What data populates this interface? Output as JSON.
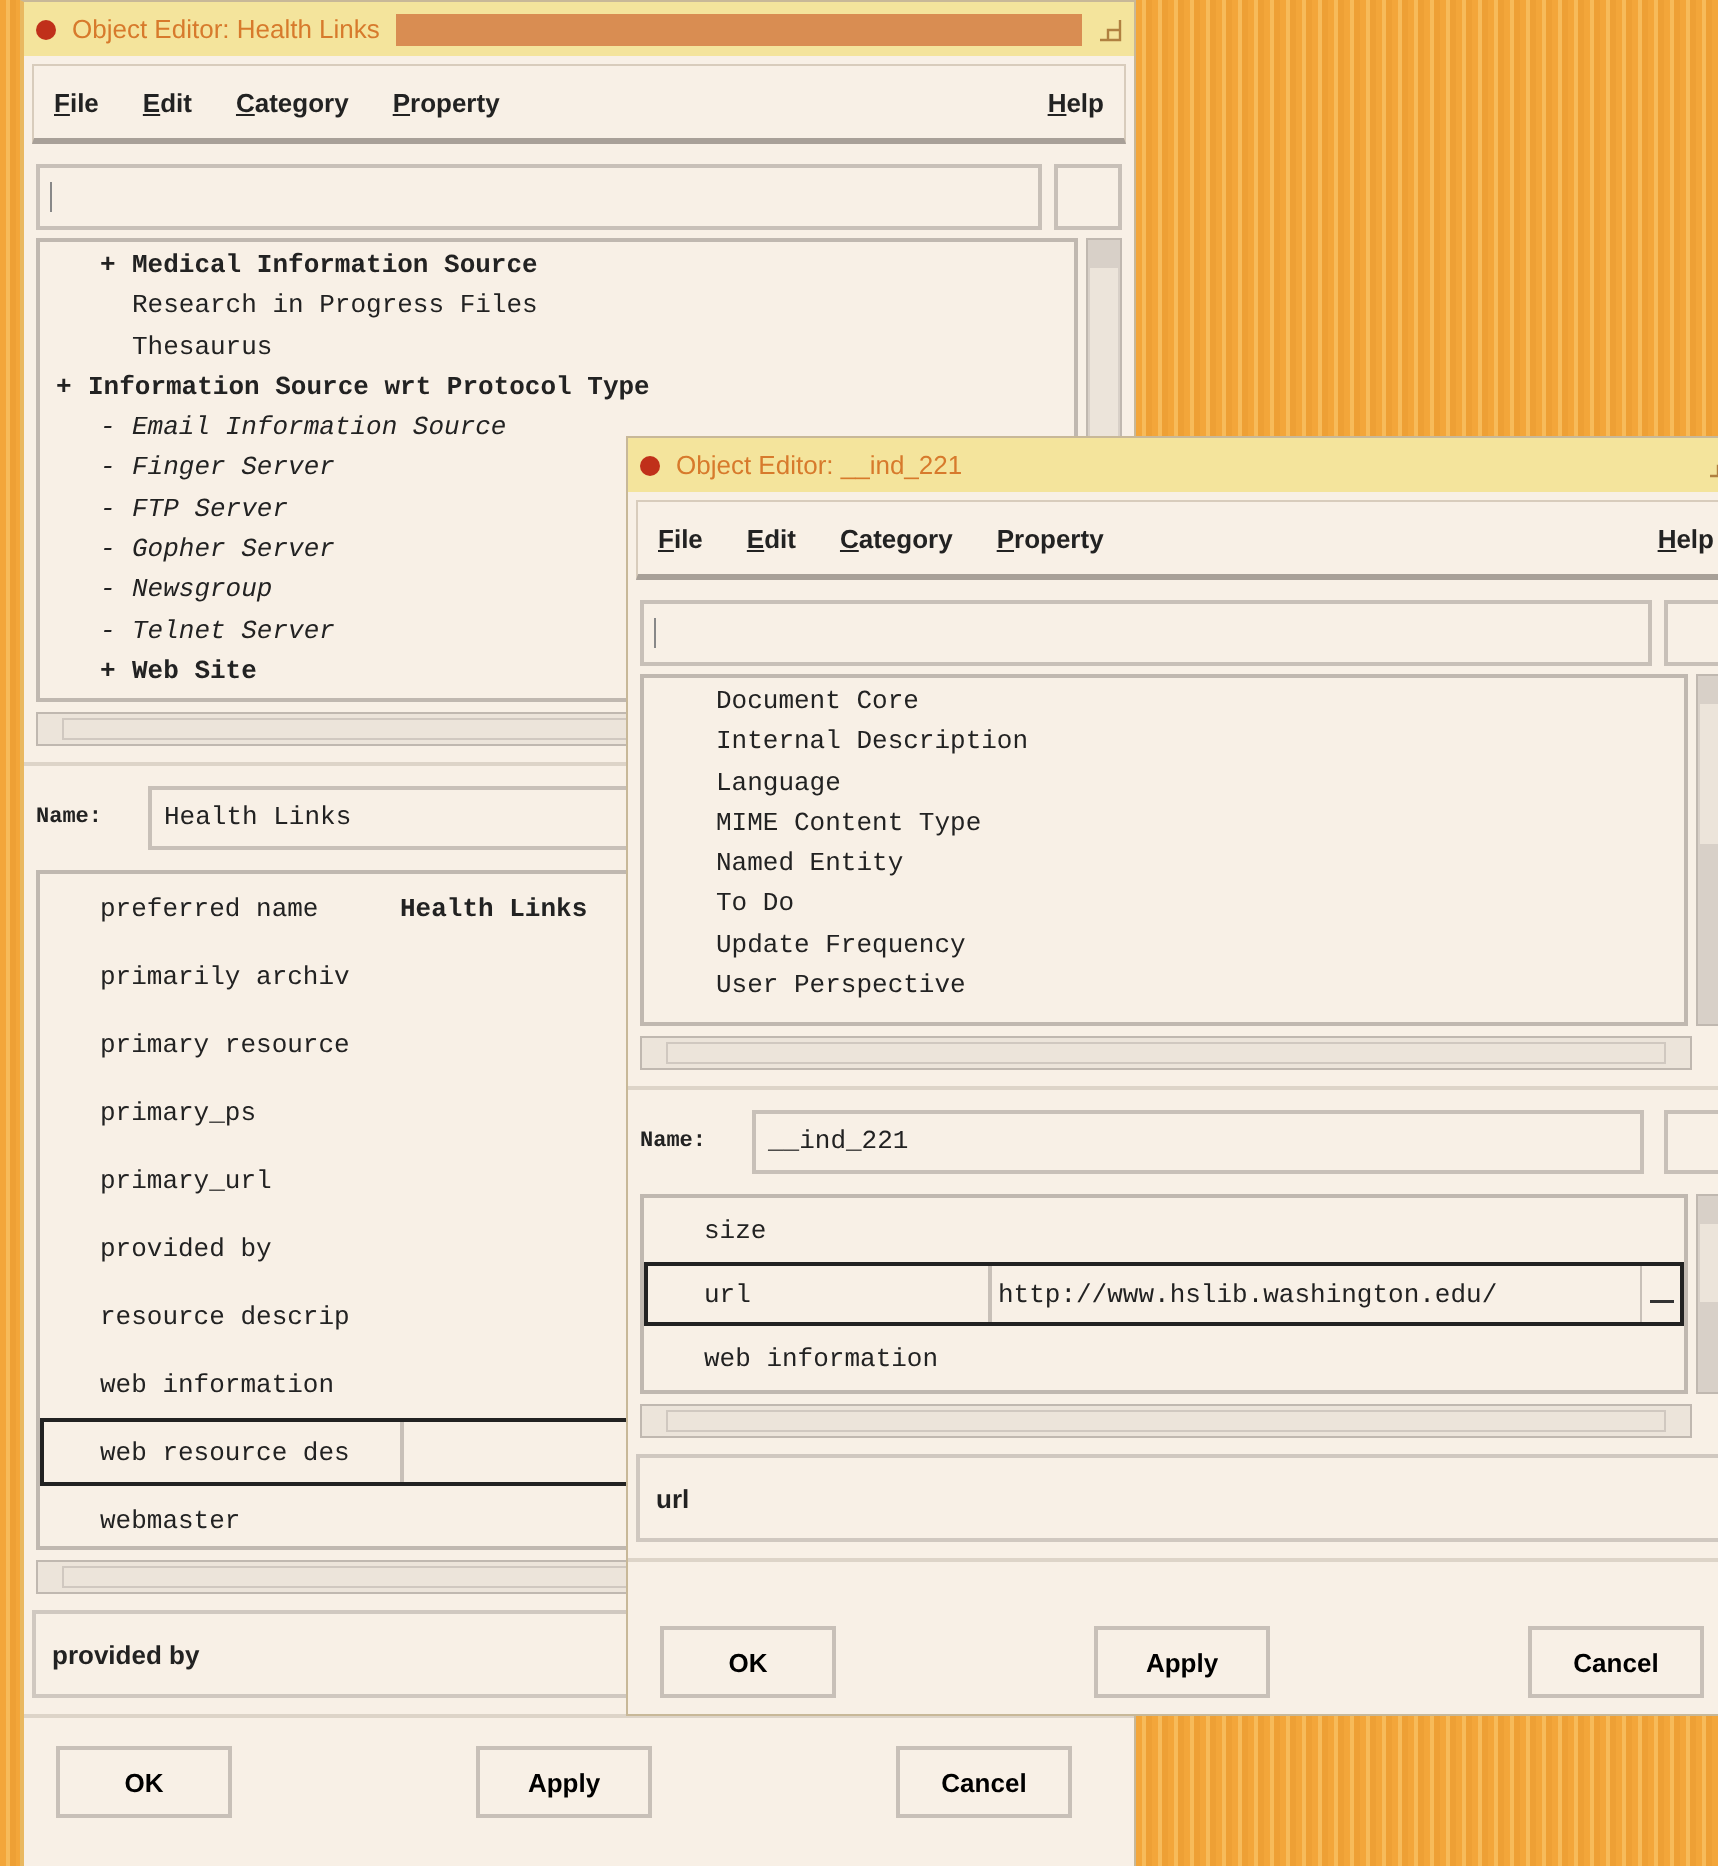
{
  "windows": [
    {
      "title": "Object Editor: Health Links",
      "menu": [
        {
          "label": "File"
        },
        {
          "label": "Edit"
        },
        {
          "label": "Category"
        },
        {
          "label": "Property"
        },
        {
          "label": "Help"
        }
      ],
      "tree": [
        {
          "children": [
            {
              "label": "Medical Information Source",
              "marker": "+",
              "kind": "bold"
            },
            {
              "label": "Research in Progress Files",
              "kind": "plain"
            },
            {
              "label": "Thesaurus",
              "kind": "plain"
            }
          ]
        },
        {
          "label": "Information Source wrt Protocol Type",
          "marker": "+",
          "kind": "bold",
          "children": [
            {
              "label": "Email Information Source",
              "marker": "-",
              "kind": "italic"
            },
            {
              "label": "Finger Server",
              "marker": "-",
              "kind": "italic"
            },
            {
              "label": "FTP Server",
              "marker": "-",
              "kind": "italic"
            },
            {
              "label": "Gopher Server",
              "marker": "-",
              "kind": "italic"
            },
            {
              "label": "Newsgroup",
              "marker": "-",
              "kind": "italic"
            },
            {
              "label": "Telnet Server",
              "marker": "-",
              "kind": "italic"
            },
            {
              "label": "Web Site",
              "marker": "+",
              "kind": "bold"
            }
          ]
        }
      ],
      "name_label": "Name:",
      "name_value": "Health Links",
      "properties": [
        {
          "name": "preferred name",
          "value": "Health Links",
          "selected": false
        },
        {
          "name": "primarily archiv",
          "selected": false
        },
        {
          "name": "primary resource",
          "selected": false
        },
        {
          "name": "primary_ps",
          "selected": false
        },
        {
          "name": "primary_url",
          "selected": false
        },
        {
          "name": "provided by",
          "selected": false
        },
        {
          "name": "resource descrip",
          "selected": false
        },
        {
          "name": "web information",
          "selected": false
        },
        {
          "name": "web resource des",
          "selected": true
        },
        {
          "name": "webmaster",
          "selected": false
        }
      ],
      "status": "provided by",
      "buttons": [
        "OK",
        "Apply",
        "Cancel"
      ]
    },
    {
      "title": "Object Editor: __ind_221",
      "menu": [
        {
          "label": "File"
        },
        {
          "label": "Edit"
        },
        {
          "label": "Category"
        },
        {
          "label": "Property"
        },
        {
          "label": "Help"
        }
      ],
      "tree": [
        {
          "label": "Document Core",
          "kind": "plain"
        },
        {
          "label": "Internal Description",
          "kind": "plain"
        },
        {
          "label": "Language",
          "kind": "plain"
        },
        {
          "label": "MIME Content Type",
          "kind": "plain"
        },
        {
          "label": "Named Entity",
          "kind": "plain"
        },
        {
          "label": "To Do",
          "kind": "plain"
        },
        {
          "label": "Update Frequency",
          "kind": "plain"
        },
        {
          "label": "User Perspective",
          "kind": "plain"
        }
      ],
      "name_label": "Name:",
      "name_value": "__ind_221",
      "properties": [
        {
          "name": "size",
          "selected": false
        },
        {
          "name": "url",
          "value": "http://www.hslib.washington.edu/",
          "selected": true
        },
        {
          "name": "web information",
          "selected": false
        }
      ],
      "status": "url",
      "buttons": [
        "OK",
        "Apply",
        "Cancel"
      ]
    }
  ]
}
